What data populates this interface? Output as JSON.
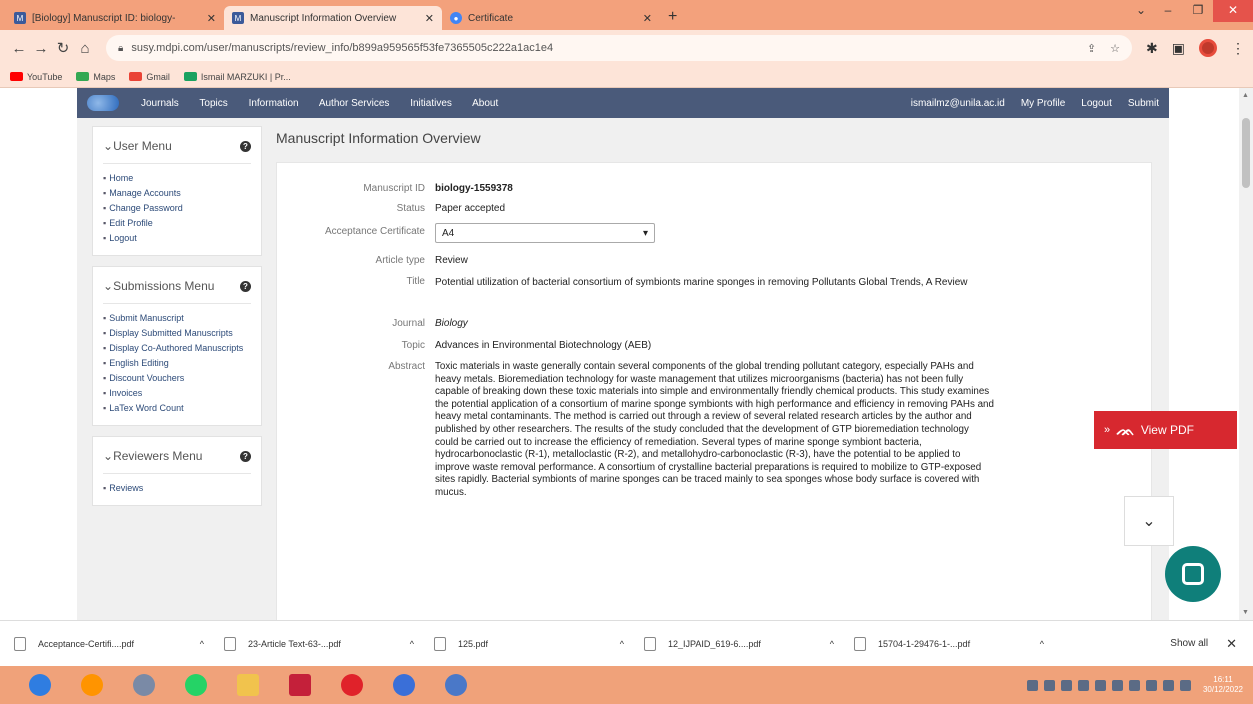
{
  "browser": {
    "tabs": [
      {
        "title": "[Biology] Manuscript ID: biology-",
        "active": false,
        "favicon": "mdpi-icon"
      },
      {
        "title": "Manuscript Information Overview",
        "active": true,
        "favicon": "mdpi-icon"
      },
      {
        "title": "Certificate",
        "active": false,
        "favicon": "chrome-icon"
      }
    ],
    "url": "susy.mdpi.com/user/manuscripts/review_info/b899a959565f53fe7365505c222a1ac1e4",
    "bookmarks": [
      {
        "label": "YouTube",
        "icon": "youtube-icon"
      },
      {
        "label": "Maps",
        "icon": "maps-icon"
      },
      {
        "label": "Gmail",
        "icon": "gmail-icon"
      },
      {
        "label": "Ismail MARZUKI | Pr...",
        "icon": "bookmark-icon"
      }
    ]
  },
  "site": {
    "nav_left": [
      "Journals",
      "Topics",
      "Information",
      "Author Services",
      "Initiatives",
      "About"
    ],
    "nav_right": [
      "ismailmz@unila.ac.id",
      "My Profile",
      "Logout",
      "Submit"
    ]
  },
  "sidebar": {
    "user_menu": {
      "title": "User Menu",
      "items": [
        "Home",
        "Manage Accounts",
        "Change Password",
        "Edit Profile",
        "Logout"
      ]
    },
    "submissions_menu": {
      "title": "Submissions Menu",
      "items": [
        "Submit Manuscript",
        "Display Submitted Manuscripts",
        "Display Co-Authored Manuscripts",
        "English Editing",
        "Discount Vouchers",
        "Invoices",
        "LaTex Word Count"
      ]
    },
    "reviewers_menu": {
      "title": "Reviewers Menu",
      "items": [
        "Reviews"
      ]
    }
  },
  "main": {
    "heading": "Manuscript Information Overview",
    "fields": {
      "manuscript_id_label": "Manuscript ID",
      "manuscript_id": "biology-1559378",
      "status_label": "Status",
      "status": "Paper accepted",
      "certificate_label": "Acceptance Certificate",
      "certificate_value": "A4",
      "article_type_label": "Article type",
      "article_type": "Review",
      "title_label": "Title",
      "title": "Potential utilization of bacterial consortium of symbionts marine sponges in removing Pollutants Global Trends, A Review",
      "journal_label": "Journal",
      "journal": "Biology",
      "topic_label": "Topic",
      "topic": "Advances in Environmental Biotechnology (AEB)",
      "abstract_label": "Abstract",
      "abstract": "Toxic materials in waste generally contain several components of the global trending pollutant category, especially PAHs and heavy metals. Bioremediation technology for waste management that utilizes microorganisms (bacteria) has not been fully capable of breaking down these toxic materials into simple and environmentally friendly chemical products. This study examines the potential application of a consortium of marine sponge symbionts with high performance and efficiency in removing PAHs and heavy metal contaminants. The method is carried out through a review of several related research articles by the author and published by other researchers. The results of the study concluded that the development of GTP bioremediation technology could be carried out to increase the efficiency of remediation. Several types of marine sponge symbiont bacteria, hydrocarbonoclastic (R-1), metalloclastic (R-2), and metallohydro-carbonoclastic (R-3), have the potential to be applied to improve waste removal performance. A consortium of crystalline bacterial preparations is required to mobilize to GTP-exposed sites rapidly. Bacterial symbionts of marine sponges can be traced mainly to sea sponges whose body surface is covered with mucus."
    },
    "view_pdf_label": "View PDF"
  },
  "downloads": {
    "items": [
      "Acceptance-Certifi....pdf",
      "23-Article Text-63-...pdf",
      "125.pdf",
      "12_IJPAID_619-6....pdf",
      "15704-1-29476-1-...pdf"
    ],
    "show_all": "Show all"
  },
  "taskbar": {
    "apps": [
      {
        "icon": "chrome-icon",
        "color": "#2f7de1"
      },
      {
        "icon": "firefox-icon",
        "color": "#ff9400"
      },
      {
        "icon": "people-icon",
        "color": "#7a8aa6"
      },
      {
        "icon": "whatsapp-icon",
        "color": "#25d366"
      },
      {
        "icon": "file-explorer-icon",
        "color": "#f1c34d"
      },
      {
        "icon": "mendeley-icon",
        "color": "#c4203a"
      },
      {
        "icon": "opera-icon",
        "color": "#e0222a"
      },
      {
        "icon": "chrome-beta-icon",
        "color": "#3a6fd8"
      },
      {
        "icon": "chrome-dev-icon",
        "color": "#4a78c8"
      }
    ],
    "time": "16:11",
    "date": "30/12/2022"
  },
  "colors": {
    "chrome_frame": "#f3a17c",
    "navbar": "#4a5a7a",
    "view_pdf": "#d7282f",
    "chat": "#0f7f7a"
  }
}
